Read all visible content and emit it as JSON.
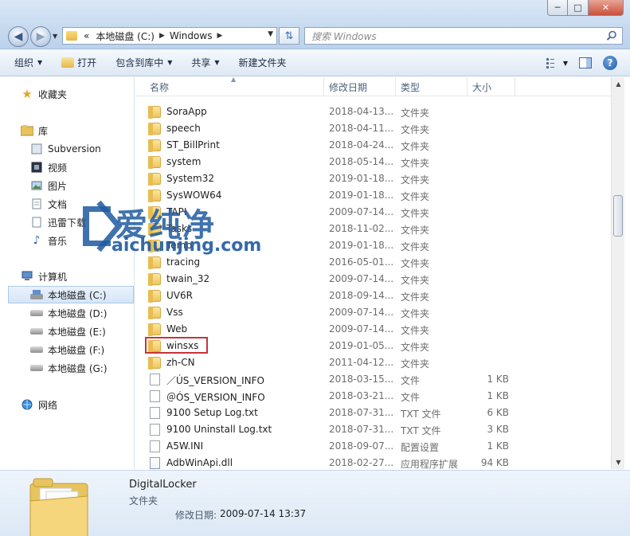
{
  "window": {
    "min_glyph": "─",
    "max_glyph": "□",
    "close_glyph": "✕"
  },
  "address": {
    "prefix": "«",
    "segments": [
      "本地磁盘 (C:)",
      "Windows"
    ]
  },
  "search": {
    "placeholder": "搜索 Windows"
  },
  "toolbar": {
    "organize": "组织",
    "open": "打开",
    "include_in_library": "包含到库中",
    "share": "共享",
    "new_folder": "新建文件夹"
  },
  "sidebar": {
    "favorites": "收藏夹",
    "libraries": "库",
    "library_items": [
      "Subversion",
      "视频",
      "图片",
      "文档",
      "迅雷下载",
      "音乐"
    ],
    "computer": "计算机",
    "drives": [
      "本地磁盘 (C:)",
      "本地磁盘 (D:)",
      "本地磁盘 (E:)",
      "本地磁盘 (F:)",
      "本地磁盘 (G:)"
    ],
    "network": "网络"
  },
  "columns": {
    "name": "名称",
    "date": "修改日期",
    "type": "类型",
    "size": "大小"
  },
  "files": [
    {
      "name": "SoraApp",
      "date": "2018-04-13...",
      "type": "文件夹",
      "size": "",
      "kind": "folder"
    },
    {
      "name": "speech",
      "date": "2018-04-11...",
      "type": "文件夹",
      "size": "",
      "kind": "folder"
    },
    {
      "name": "ST_BillPrint",
      "date": "2018-04-24...",
      "type": "文件夹",
      "size": "",
      "kind": "folder"
    },
    {
      "name": "system",
      "date": "2018-05-14...",
      "type": "文件夹",
      "size": "",
      "kind": "folder"
    },
    {
      "name": "System32",
      "date": "2019-01-18...",
      "type": "文件夹",
      "size": "",
      "kind": "folder"
    },
    {
      "name": "SysWOW64",
      "date": "2019-01-18...",
      "type": "文件夹",
      "size": "",
      "kind": "folder"
    },
    {
      "name": "TAPI",
      "date": "2009-07-14...",
      "type": "文件夹",
      "size": "",
      "kind": "folder"
    },
    {
      "name": "Tasks",
      "date": "2018-11-02...",
      "type": "文件夹",
      "size": "",
      "kind": "folder"
    },
    {
      "name": "Temp",
      "date": "2019-01-18...",
      "type": "文件夹",
      "size": "",
      "kind": "folder"
    },
    {
      "name": "tracing",
      "date": "2016-05-01...",
      "type": "文件夹",
      "size": "",
      "kind": "folder"
    },
    {
      "name": "twain_32",
      "date": "2009-07-14...",
      "type": "文件夹",
      "size": "",
      "kind": "folder"
    },
    {
      "name": "UV6R",
      "date": "2018-09-14...",
      "type": "文件夹",
      "size": "",
      "kind": "folder"
    },
    {
      "name": "Vss",
      "date": "2009-07-14...",
      "type": "文件夹",
      "size": "",
      "kind": "folder"
    },
    {
      "name": "Web",
      "date": "2009-07-14...",
      "type": "文件夹",
      "size": "",
      "kind": "folder"
    },
    {
      "name": "winsxs",
      "date": "2019-01-05...",
      "type": "文件夹",
      "size": "",
      "kind": "folder"
    },
    {
      "name": "zh-CN",
      "date": "2011-04-12...",
      "type": "文件夹",
      "size": "",
      "kind": "folder"
    },
    {
      "name": "／ÚS_VERSION_INFO",
      "date": "2018-03-15...",
      "type": "文件",
      "size": "1 KB",
      "kind": "file"
    },
    {
      "name": "＠ÓS_VERSION_INFO",
      "date": "2018-03-21...",
      "type": "文件",
      "size": "1 KB",
      "kind": "file"
    },
    {
      "name": "9100 Setup Log.txt",
      "date": "2018-07-31...",
      "type": "TXT 文件",
      "size": "6 KB",
      "kind": "file"
    },
    {
      "name": "9100 Uninstall Log.txt",
      "date": "2018-07-31...",
      "type": "TXT 文件",
      "size": "3 KB",
      "kind": "file"
    },
    {
      "name": "A5W.INI",
      "date": "2018-09-07...",
      "type": "配置设置",
      "size": "1 KB",
      "kind": "ini"
    },
    {
      "name": "AdbWinApi.dll",
      "date": "2018-02-27...",
      "type": "应用程序扩展",
      "size": "94 KB",
      "kind": "dll"
    }
  ],
  "watermark": {
    "text": "爱纯净",
    "url": "aichunjing.com"
  },
  "details": {
    "name": "DigitalLocker",
    "type": "文件夹",
    "date_label": "修改日期:",
    "date_value": "2009-07-14 13:37"
  },
  "colors": {
    "highlight_border": "#c8333a",
    "folder_yellow": "#efc560",
    "selected_drive_bg": "#d6e6f8"
  }
}
